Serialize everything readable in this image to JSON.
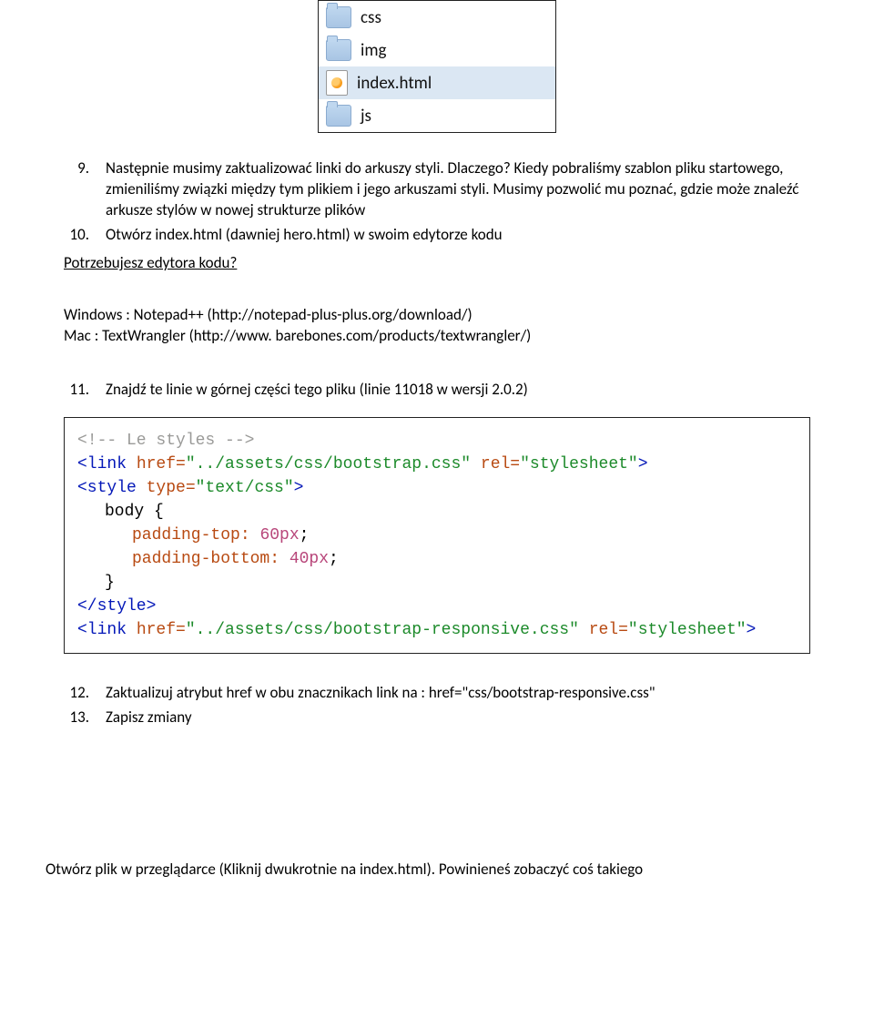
{
  "filebox": {
    "items": [
      {
        "name": "css",
        "type": "folder",
        "selected": false
      },
      {
        "name": "img",
        "type": "folder",
        "selected": false
      },
      {
        "name": "index.html",
        "type": "html",
        "selected": true
      },
      {
        "name": "js",
        "type": "folder",
        "selected": false
      }
    ]
  },
  "step9": {
    "num": "9.",
    "text": "Następnie musimy zaktualizować linki do arkuszy styli. Dlaczego? Kiedy pobraliśmy szablon pliku startowego, zmieniliśmy związki między tym plikiem i jego arkuszami styli. Musimy pozwolić mu poznać, gdzie może znaleźć arkusze stylów w nowej strukturze plików"
  },
  "step10": {
    "num": "10.",
    "text": "Otwórz index.html (dawniej hero.html) w swoim edytorze kodu"
  },
  "editor_heading": "Potrzebujesz edytora kodu?",
  "editors": {
    "line1": "Windows : Notepad++ (http://notepad-plus-plus.org/download/)",
    "line2": "Mac : TextWrangler (http://www. barebones.com/products/textwrangler/)"
  },
  "step11": {
    "num": "11.",
    "text": "Znajdź te linie w górnej części tego pliku (linie 11018 w wersji 2.0.2)"
  },
  "code": {
    "comment": "<!-- Le styles -->",
    "link1_pre": "<link ",
    "link1_href_attr": "href=",
    "link1_href_val": "\"../assets/css/bootstrap.css\"",
    "link1_rel_attr": " rel=",
    "link1_rel_val": "\"stylesheet\"",
    "link1_post": ">",
    "style_open_pre": "<style ",
    "style_type_attr": "type=",
    "style_type_val": "\"text/css\"",
    "style_open_post": ">",
    "body_sel": "body {",
    "pad_top": "padding-top: ",
    "pad_top_val": "60px",
    "pad_bot": "padding-bottom: ",
    "pad_bot_val": "40px",
    "semi": ";",
    "close_brace": "}",
    "style_close": "</style>",
    "link2_pre": "<link ",
    "link2_href_attr": "href=",
    "link2_href_val": "\"../assets/css/bootstrap-responsive.css\"",
    "link2_rel_attr": " rel=",
    "link2_rel_val": "\"stylesheet\"",
    "link2_post": ">"
  },
  "step12": {
    "num": "12.",
    "text": "Zaktualizuj atrybut href w obu znacznikach link na : href=\"css/bootstrap-responsive.css\""
  },
  "step13": {
    "num": "13.",
    "text": "Zapisz zmiany"
  },
  "footer": "Otwórz plik w przeglądarce (Kliknij dwukrotnie na index.html). Powinieneś zobaczyć coś takiego"
}
